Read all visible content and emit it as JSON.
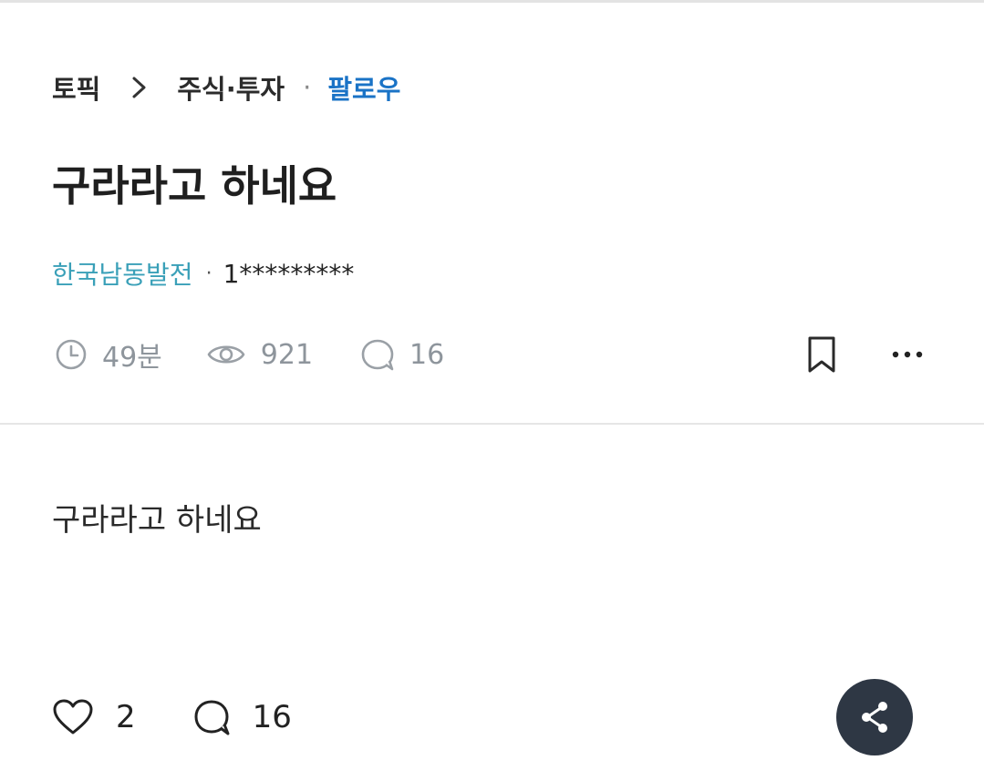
{
  "breadcrumb": {
    "root": "토픽",
    "category": "주식·투자",
    "separator": "·",
    "follow_label": "팔로우"
  },
  "post": {
    "title": "구라라고 하네요",
    "company": "한국남동발전",
    "author_separator": "·",
    "author": "1*********",
    "body": "구라라고 하네요"
  },
  "meta": {
    "time_ago": "49분",
    "views": "921",
    "comments": "16"
  },
  "actions": {
    "likes": "2",
    "comments": "16"
  },
  "colors": {
    "follow": "#1a73c6",
    "company": "#3aa0b8",
    "meta_gray": "#8e959c",
    "fab_background": "#2e3744"
  },
  "icons": {
    "breadcrumb": "chevron-right-icon",
    "time": "clock-icon",
    "views": "eye-icon",
    "comments": "speech-bubble-icon",
    "bookmark": "bookmark-icon",
    "more": "more-horizontal-icon",
    "like": "heart-icon",
    "share": "share-icon"
  }
}
